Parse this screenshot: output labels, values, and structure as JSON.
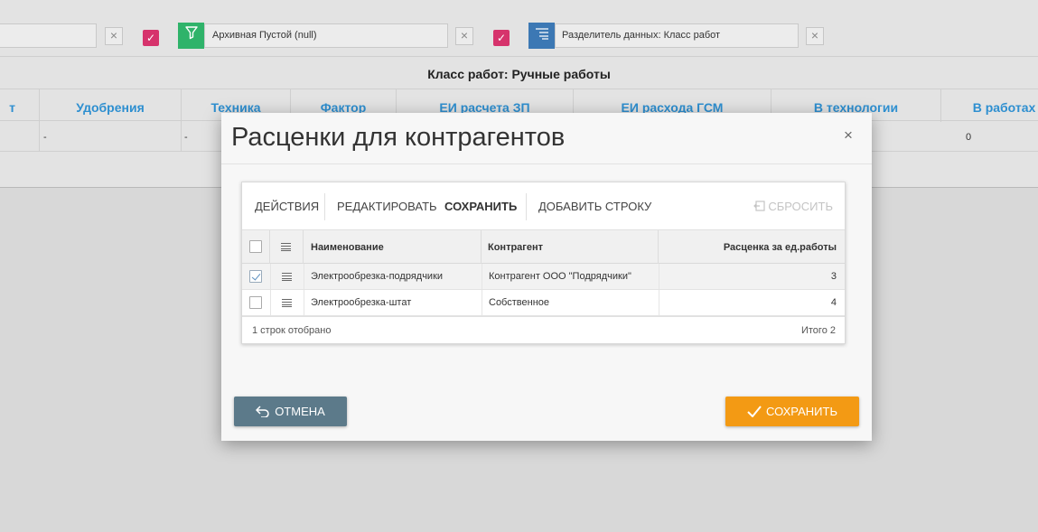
{
  "filters": {
    "filter1_value": "",
    "filter2_value": "Архивная Пустой (null)",
    "filter3_value": "Разделитель данных: Класс работ"
  },
  "background": {
    "class_title": "Класс работ: Ручные работы",
    "columns": [
      "т",
      "Удобрения",
      "Техника",
      "Фактор",
      "ЕИ расчета ЗП",
      "ЕИ расхода ГСМ",
      "В технологии",
      "В работах"
    ],
    "row": [
      "-",
      "-",
      "0"
    ]
  },
  "modal": {
    "title": "Расценки для контрагентов",
    "close_icon": "×",
    "toolbar": {
      "actions": "ДЕЙСТВИЯ",
      "edit": "РЕДАКТИРОВАТЬ",
      "save": "СОХРАНИТЬ",
      "add_row": "ДОБАВИТЬ СТРОКУ",
      "reset": "СБРОСИТЬ"
    },
    "table": {
      "headers": [
        "Наименование",
        "Контрагент",
        "Расценка за ед.работы"
      ],
      "rows": [
        {
          "name": "Электрообрезка-подрядчики",
          "contractor": "Контрагент ООО \"Подрядчики\"",
          "rate": "3",
          "checked": true
        },
        {
          "name": "Электрообрезка-штат",
          "contractor": "Собственное",
          "rate": "4",
          "checked": false
        }
      ],
      "footer_left": "1 строк отобрано",
      "footer_right": "Итого 2"
    },
    "cancel_label": "ОТМЕНА",
    "save_label": "СОХРАНИТЬ"
  },
  "colors": {
    "accent_blue": "#2e8fd0",
    "checkbox_pink": "#d6336c",
    "filter_green": "#2fb36a",
    "filter_blue": "#3c78b4",
    "save_orange": "#f39a14",
    "cancel_slate": "#5c7a8a"
  },
  "icons": [
    "close-icon",
    "filter-icon",
    "separator-icon",
    "check-icon",
    "list-lines-icon",
    "undo-icon",
    "reset-icon"
  ]
}
